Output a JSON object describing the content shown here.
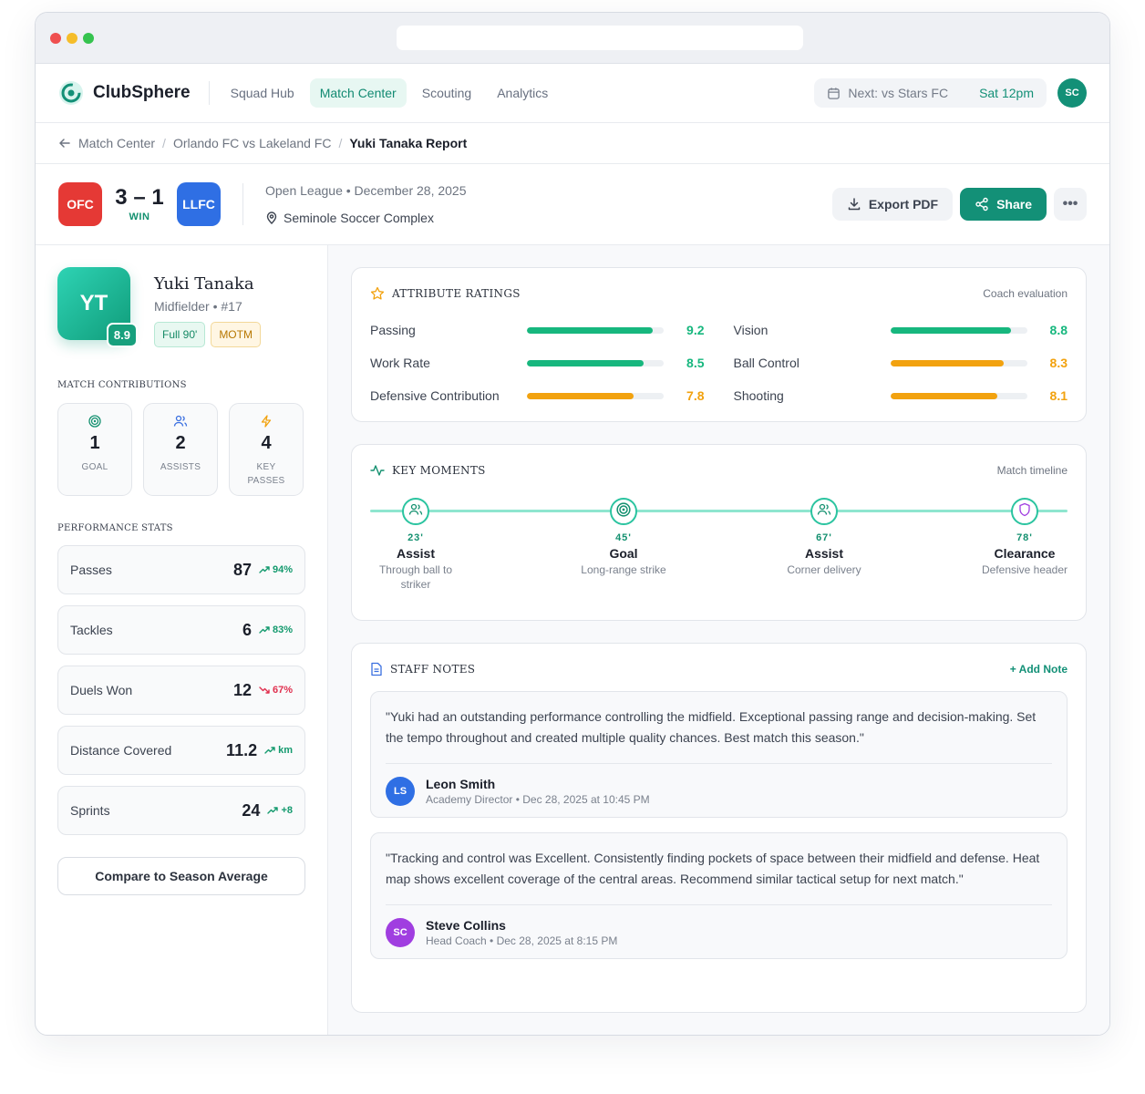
{
  "app": {
    "name": "ClubSphere"
  },
  "nav": {
    "links": [
      "Squad Hub",
      "Match Center",
      "Scouting",
      "Analytics"
    ],
    "active": 1,
    "next_label": "Next: vs Stars FC",
    "next_time": "Sat 12pm",
    "user_initials": "SC"
  },
  "breadcrumb": [
    "Match Center",
    "Orlando FC vs Lakeland FC",
    "Yuki Tanaka Report"
  ],
  "match": {
    "home": "OFC",
    "away": "LLFC",
    "score": "3 – 1",
    "result": "WIN",
    "competition": "Open League • December 28, 2025",
    "venue": "Seminole Soccer Complex",
    "export_label": "Export PDF",
    "share_label": "Share",
    "more_label": "•••"
  },
  "player": {
    "initials": "YT",
    "rating": "8.9",
    "name": "Yuki Tanaka",
    "position": "Midfielder • #17",
    "tags": [
      "Full 90'",
      "MOTM"
    ]
  },
  "contributions": {
    "title": "Match Contributions",
    "items": [
      {
        "value": "1",
        "label": "GOAL"
      },
      {
        "value": "2",
        "label": "ASSISTS"
      },
      {
        "value": "4",
        "label": "KEY PASSES"
      }
    ]
  },
  "performance": {
    "title": "Performance Stats",
    "items": [
      {
        "label": "Passes",
        "value": "87",
        "trend": "94%",
        "dir": "up"
      },
      {
        "label": "Tackles",
        "value": "6",
        "trend": "83%",
        "dir": "up"
      },
      {
        "label": "Duels Won",
        "value": "12",
        "trend": "67%",
        "dir": "down"
      },
      {
        "label": "Distance Covered",
        "value": "11.2",
        "trend": "km",
        "dir": "up"
      },
      {
        "label": "Sprints",
        "value": "24",
        "trend": "+8",
        "dir": "up"
      }
    ],
    "compare_label": "Compare to Season Average"
  },
  "ratings": {
    "title": "ATTRIBUTE RATINGS",
    "subtitle": "Coach evaluation",
    "items": [
      {
        "label": "Passing",
        "value": "9.2",
        "level": 0.92,
        "color": "#17b77e"
      },
      {
        "label": "Vision",
        "value": "8.8",
        "level": 0.88,
        "color": "#17b77e"
      },
      {
        "label": "Work Rate",
        "value": "8.5",
        "level": 0.85,
        "color": "#17b77e"
      },
      {
        "label": "Ball Control",
        "value": "8.3",
        "level": 0.83,
        "color": "#f2a20f"
      },
      {
        "label": "Defensive Contribution",
        "value": "7.8",
        "level": 0.78,
        "color": "#f2a20f"
      },
      {
        "label": "Shooting",
        "value": "8.1",
        "level": 0.78,
        "color": "#f2a20f"
      }
    ]
  },
  "moments": {
    "title": "KEY MOMENTS",
    "subtitle": "Match timeline",
    "items": [
      {
        "minute": "23'",
        "type": "Assist",
        "desc": "Through ball to striker",
        "icon": "users-icon"
      },
      {
        "minute": "45'",
        "type": "Goal",
        "desc": "Long-range strike",
        "icon": "target-icon"
      },
      {
        "minute": "67'",
        "type": "Assist",
        "desc": "Corner delivery",
        "icon": "users-icon"
      },
      {
        "minute": "78'",
        "type": "Clearance",
        "desc": "Defensive header",
        "icon": "shield-icon"
      }
    ]
  },
  "notes": {
    "title": "STAFF NOTES",
    "add_label": "+ Add Note",
    "items": [
      {
        "text": "\"Yuki had an outstanding performance controlling the midfield. Exceptional passing range and decision-making. Set the tempo throughout and created multiple quality chances. Best match this season.\"",
        "initials": "LS",
        "name": "Leon Smith",
        "role": "Academy Director • Dec 28, 2025 at 10:45 PM",
        "color": "#2f6fe4"
      },
      {
        "text": "\"Tracking and control was Excellent.  Consistently finding pockets of space between their midfield and defense. Heat map shows excellent coverage of the central areas. Recommend similar tactical setup for next match.\"",
        "initials": "SC",
        "name": "Steve Collins",
        "role": "Head Coach • Dec 28, 2025 at 8:15 PM",
        "color": "#a03ee0"
      }
    ]
  }
}
